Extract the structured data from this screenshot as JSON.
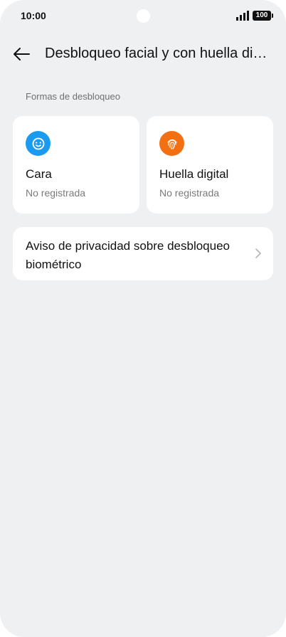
{
  "status_bar": {
    "time": "10:00",
    "battery": "100",
    "icons": [
      "signal-icon",
      "battery-icon"
    ]
  },
  "header": {
    "title": "Desbloqueo facial y con huella digital",
    "back_icon": "back-arrow-icon"
  },
  "section": {
    "label": "Formas de desbloqueo"
  },
  "methods": [
    {
      "title": "Cara",
      "status": "No registrada",
      "icon": "face-icon",
      "color": "#1a9bf0"
    },
    {
      "title": "Huella digital",
      "status": "No registrada",
      "icon": "fingerprint-icon",
      "color": "#f37012"
    }
  ],
  "privacy": {
    "label": "Aviso de privacidad sobre desbloqueo biométrico",
    "icon": "chevron-right-icon"
  }
}
